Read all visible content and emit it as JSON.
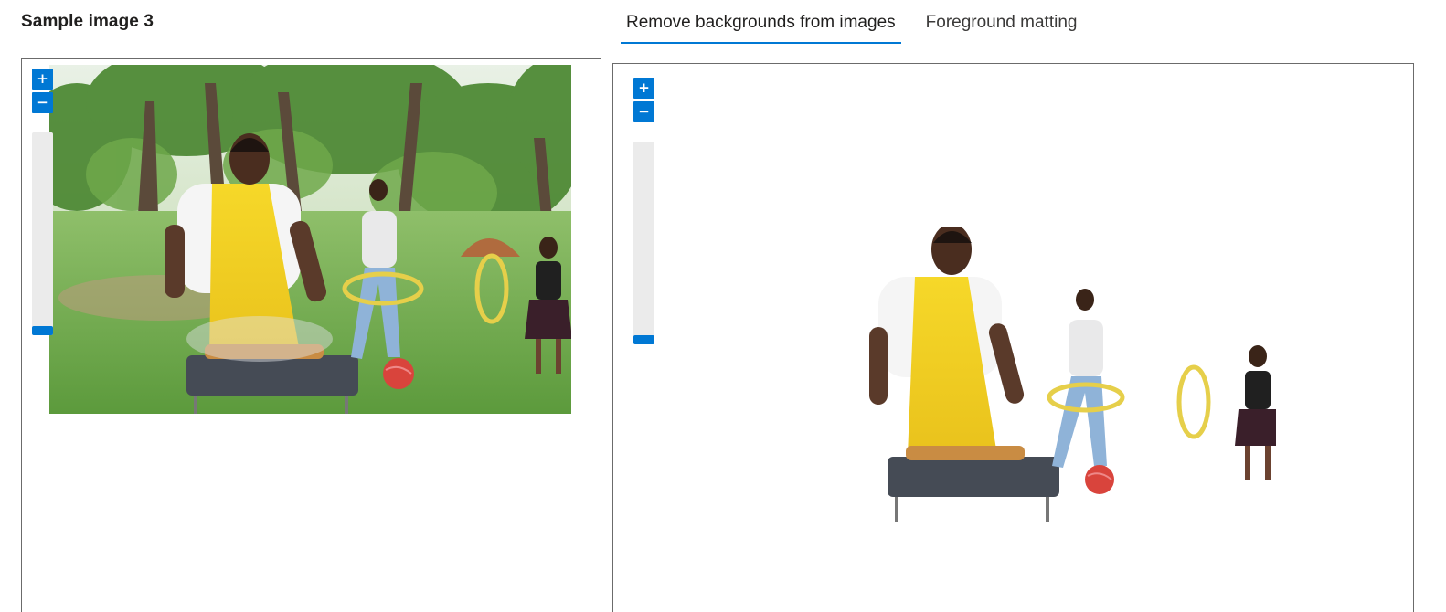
{
  "sample": {
    "title": "Sample image 3"
  },
  "tabs": [
    {
      "label": "Remove backgrounds from images",
      "active": true
    },
    {
      "label": "Foreground matting",
      "active": false
    }
  ],
  "zoom": {
    "in_label": "+",
    "out_label": "−"
  },
  "colors": {
    "accent": "#0078d4",
    "apron": "#f4d21f",
    "grass": "#6aa84f",
    "ball": "#d9443c"
  },
  "icons": {
    "zoom_in": "plus-icon",
    "zoom_out": "minus-icon"
  }
}
